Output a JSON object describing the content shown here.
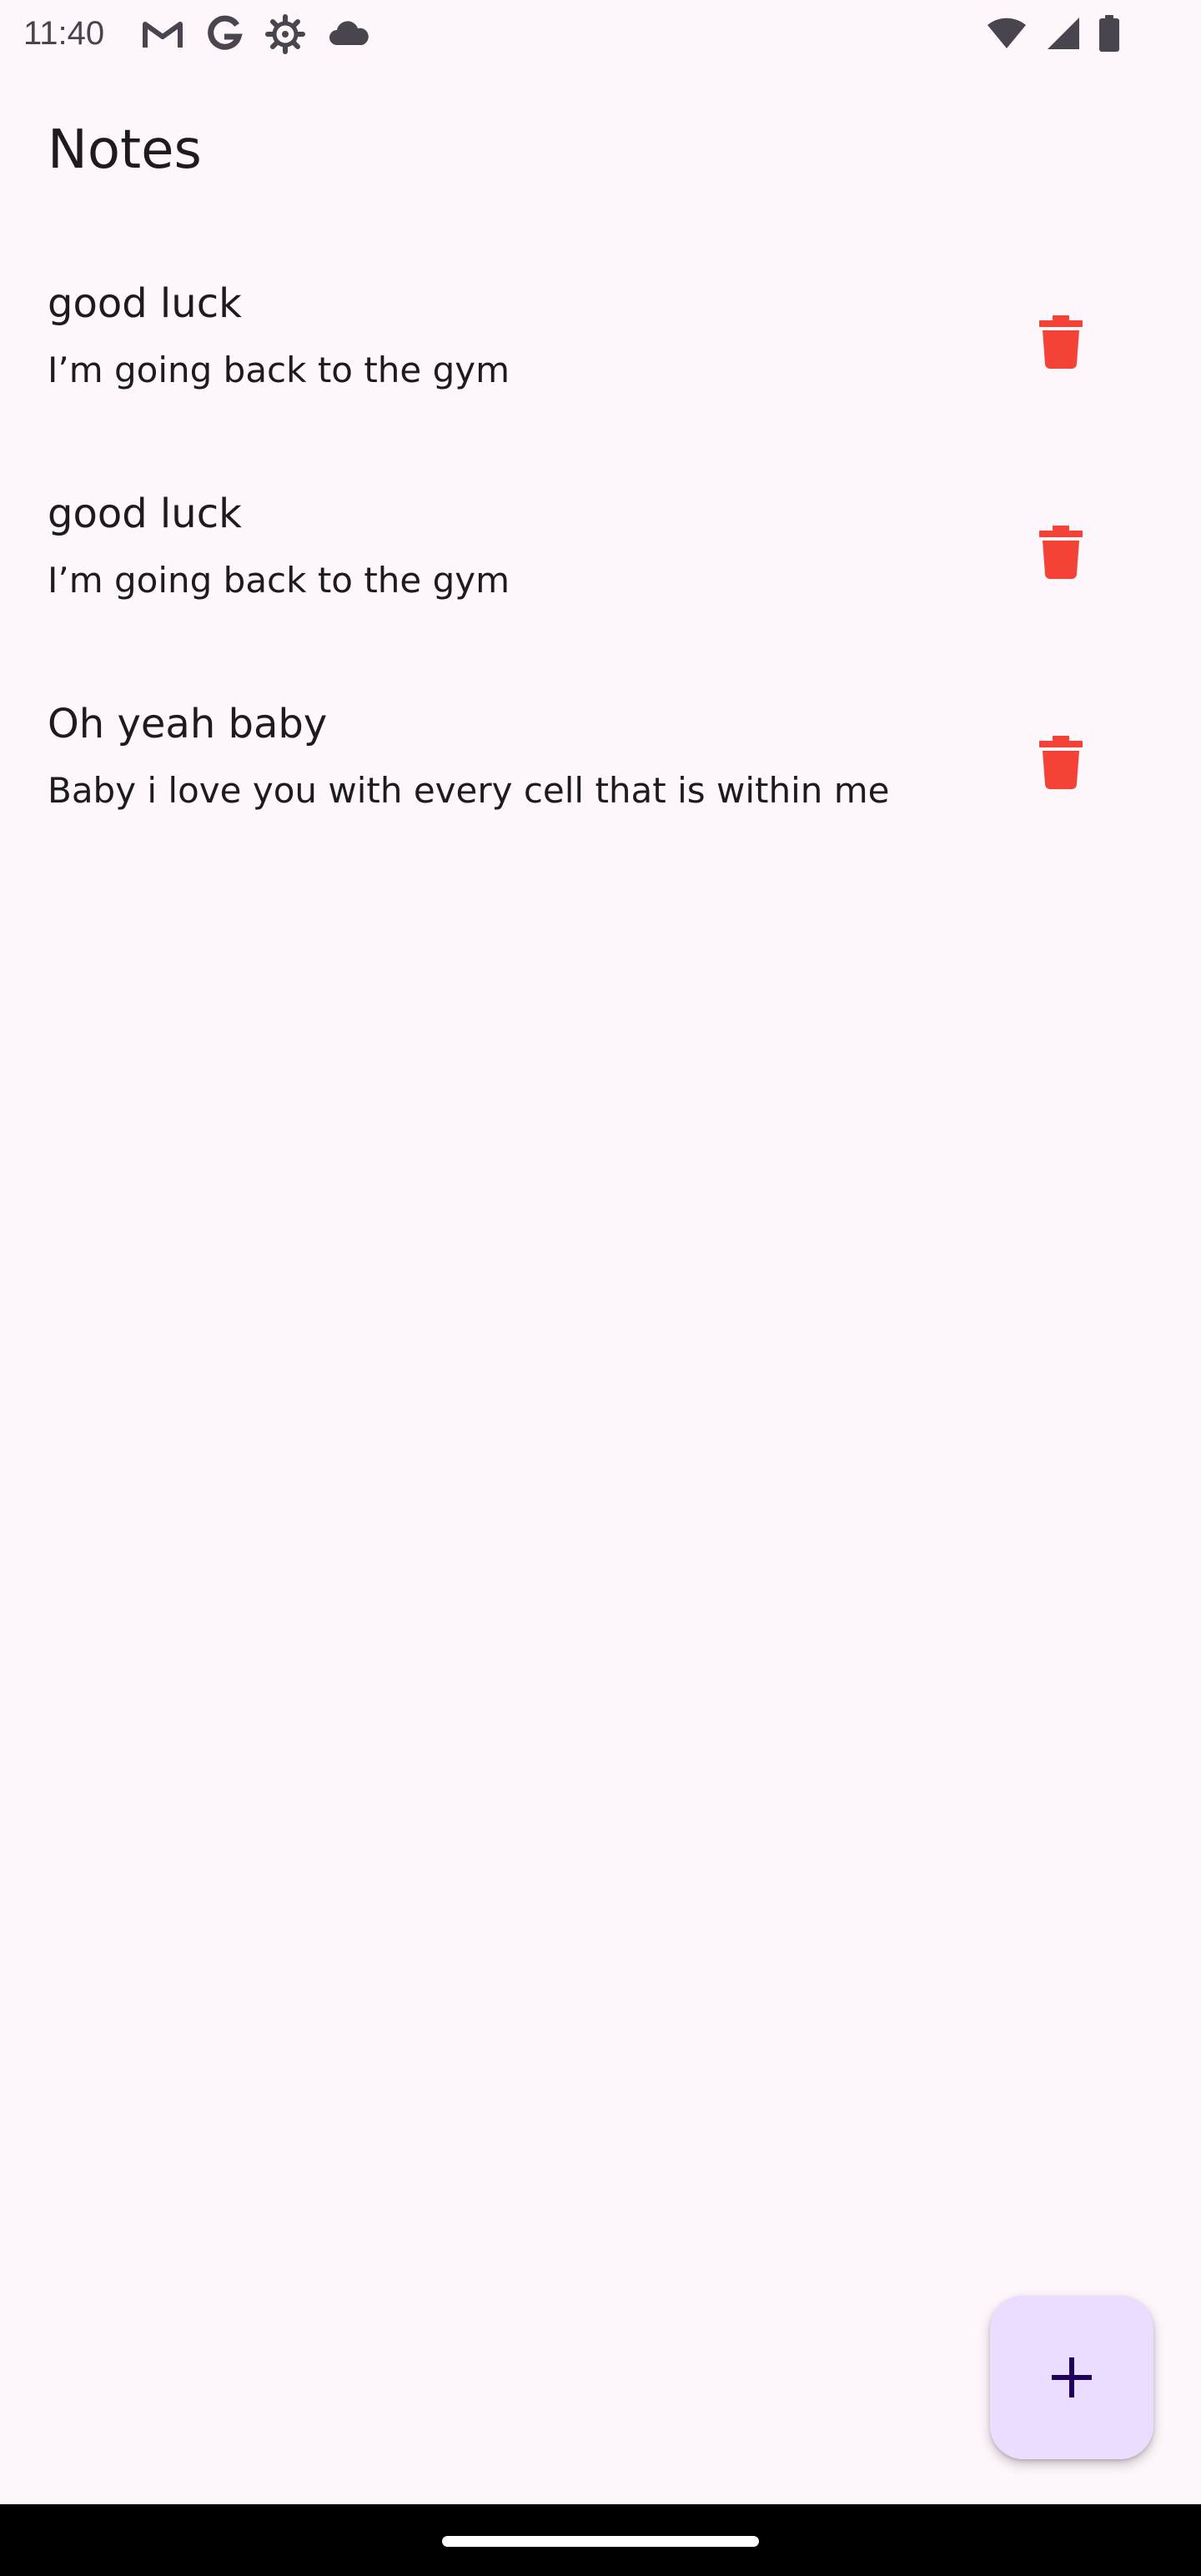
{
  "status_bar": {
    "time": "11:40",
    "left_icons": [
      "gmail-icon",
      "google-icon",
      "settings-gear-icon",
      "cloud-icon"
    ],
    "right_icons": [
      "wifi-icon",
      "signal-icon",
      "battery-icon"
    ]
  },
  "app_bar": {
    "title": "Notes"
  },
  "notes": [
    {
      "title": "good luck",
      "body": "I’m going back to the gym",
      "action_icon": "trash-icon"
    },
    {
      "title": "good luck",
      "body": "I’m going back to the gym",
      "action_icon": "trash-icon"
    },
    {
      "title": "Oh yeah baby",
      "body": "Baby i love you with every cell that is within me",
      "action_icon": "trash-icon"
    }
  ],
  "fab": {
    "icon": "plus-icon"
  },
  "colors": {
    "background": "#fdf7fb",
    "text": "#1d1b20",
    "delete_red": "#f44336",
    "fab_background": "#eaddff",
    "fab_icon": "#21005d",
    "nav_bar": "#000000"
  }
}
